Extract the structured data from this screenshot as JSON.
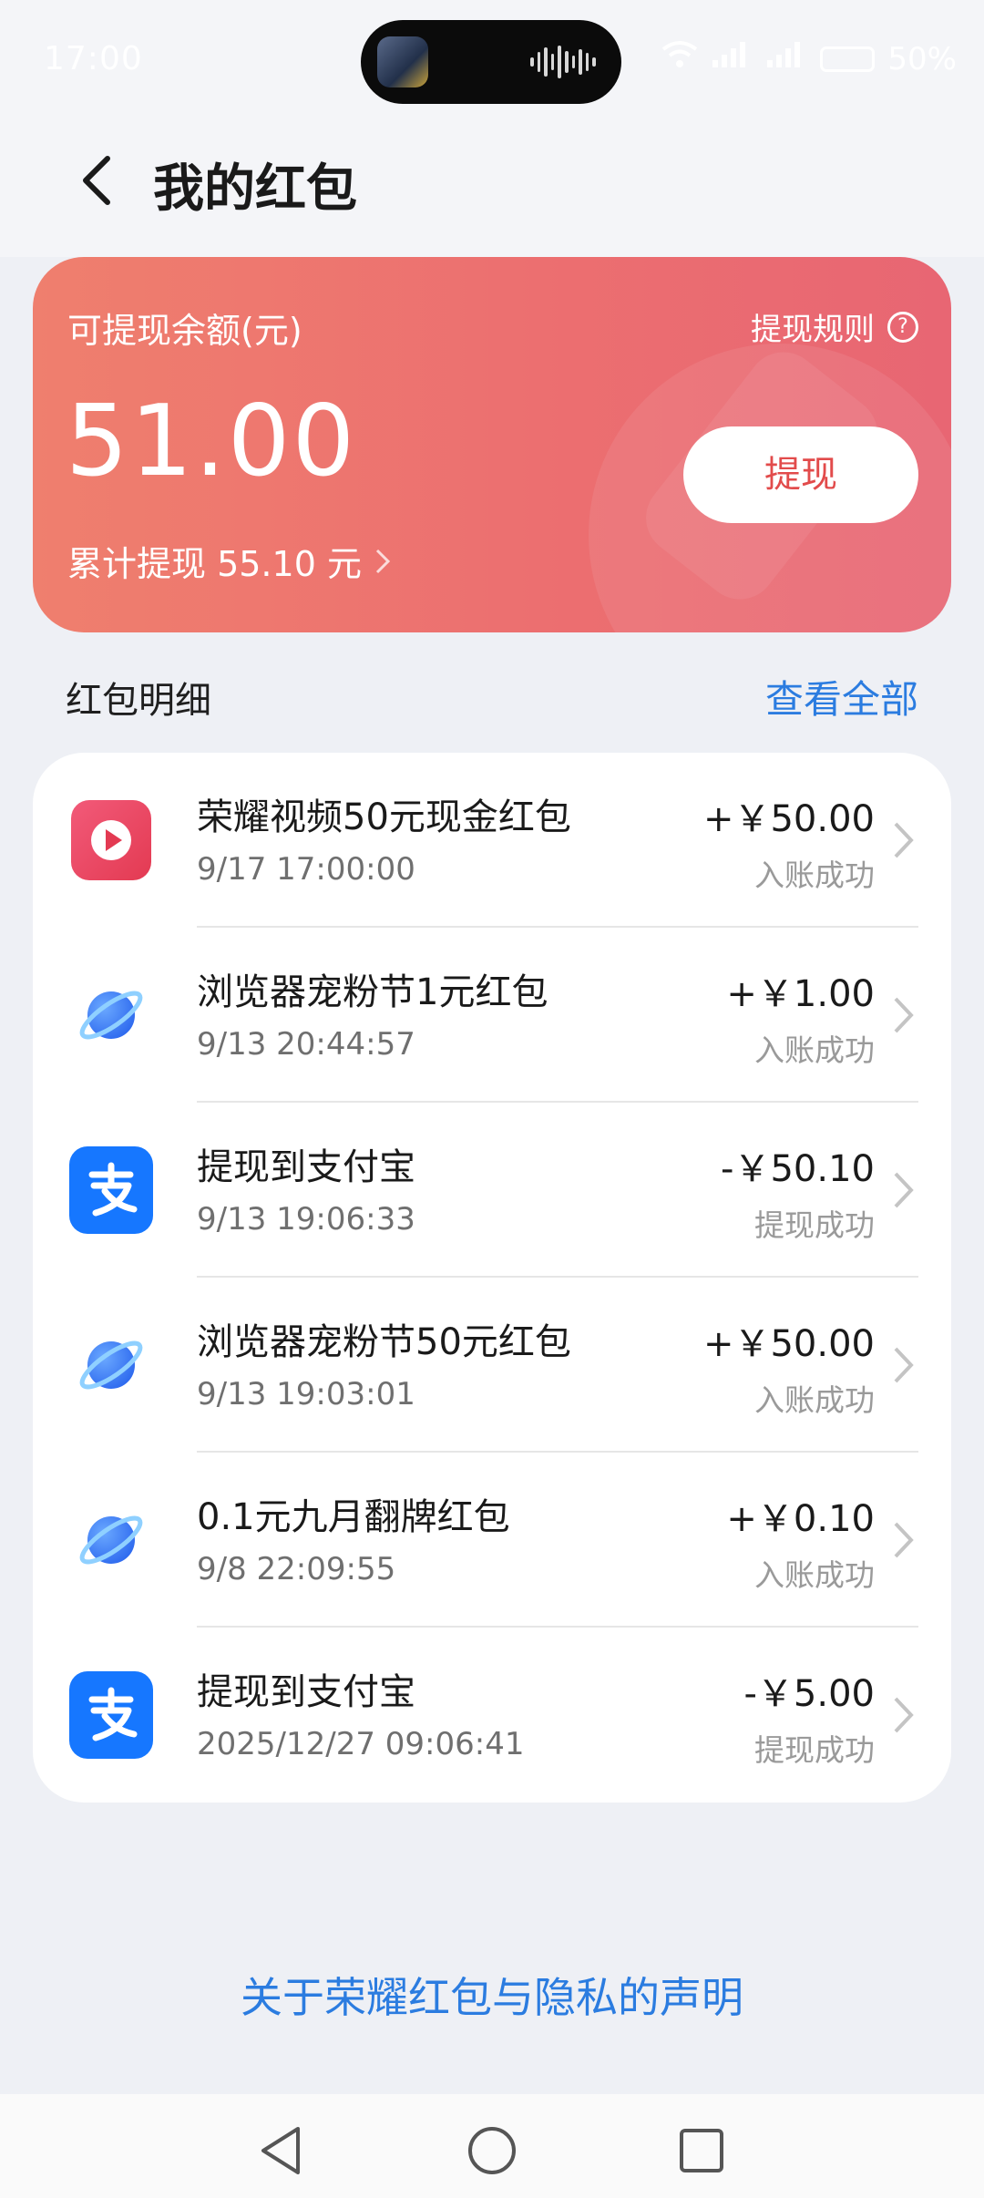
{
  "status_bar": {
    "time": "17:00",
    "battery": "50%"
  },
  "header": {
    "title": "我的红包"
  },
  "balance_card": {
    "label": "可提现余额(元)",
    "rules_label": "提现规则",
    "amount": "51.00",
    "total_withdrawn": "累计提现 55.10 元",
    "withdraw_button": "提现",
    "gradient_start": "#ef7f6e",
    "gradient_end": "#e86673"
  },
  "details": {
    "section_title": "红包明细",
    "view_all": "查看全部",
    "items": [
      {
        "icon": "honor-video-icon",
        "title": "荣耀视频50元现金红包",
        "time": "9/17 17:00:00",
        "amount": "+￥50.00",
        "status": "入账成功"
      },
      {
        "icon": "browser-planet-icon",
        "title": "浏览器宠粉节1元红包",
        "time": "9/13 20:44:57",
        "amount": "+￥1.00",
        "status": "入账成功"
      },
      {
        "icon": "alipay-icon",
        "title": "提现到支付宝",
        "time": "9/13 19:06:33",
        "amount": "-￥50.10",
        "status": "提现成功"
      },
      {
        "icon": "browser-planet-icon",
        "title": "浏览器宠粉节50元红包",
        "time": "9/13 19:03:01",
        "amount": "+￥50.00",
        "status": "入账成功"
      },
      {
        "icon": "browser-planet-icon",
        "title": "0.1元九月翻牌红包",
        "time": "9/8 22:09:55",
        "amount": "+￥0.10",
        "status": "入账成功"
      },
      {
        "icon": "alipay-icon",
        "title": "提现到支付宝",
        "time": "2025/12/27 09:06:41",
        "amount": "-￥5.00",
        "status": "提现成功"
      }
    ]
  },
  "footer": {
    "privacy_statement": "关于荣耀红包与隐私的声明"
  },
  "colors": {
    "accent_blue": "#2b7ce0",
    "withdraw_red": "#e24b4b",
    "background": "#eef0f5"
  }
}
